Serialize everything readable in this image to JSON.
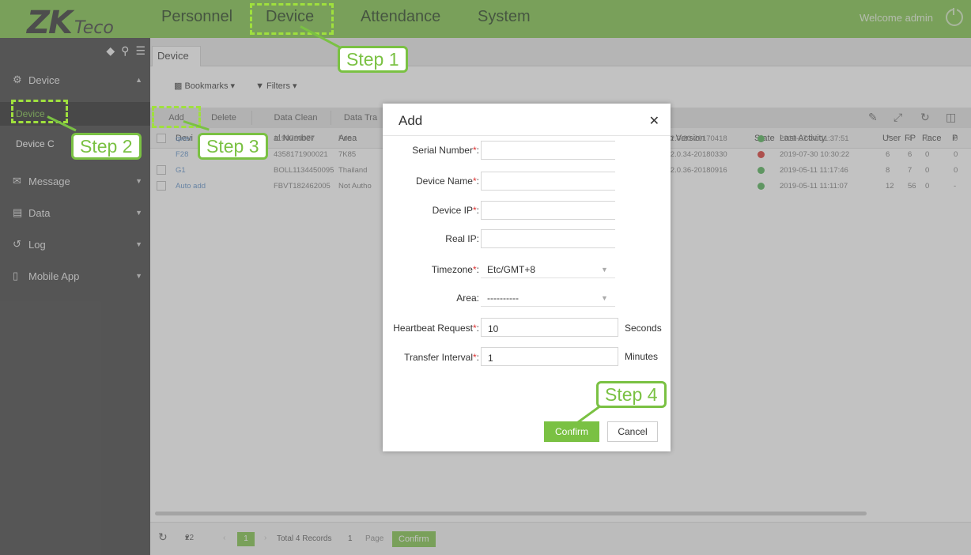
{
  "brand": {
    "logo_main": "ZK",
    "logo_sub": "Teco"
  },
  "nav": [
    "Personnel",
    "Device",
    "Attendance",
    "System"
  ],
  "welcome": "Welcome admin",
  "sidebar": {
    "groups": {
      "device": "Device",
      "message": "Message",
      "data": "Data",
      "log": "Log",
      "mobile": "Mobile App"
    },
    "items": [
      "Device",
      "Device C"
    ]
  },
  "tab": "Device",
  "filters": {
    "bookmarks": "Bookmarks",
    "filters": "Filters"
  },
  "toolbar": [
    "Add",
    "Delete",
    "Data Clean",
    "Data Tra"
  ],
  "grid": {
    "headers": {
      "device": "Devi",
      "serial": "al Number",
      "area": "Area",
      "fw": "sh Version",
      "state": "State",
      "last": "Last Activity",
      "user": "User",
      "fp": "FP",
      "face": "Face",
      "p": "P"
    },
    "rows": [
      {
        "name": "qwer",
        "serial": "1190760077",
        "area": "Prin",
        "fw": "r 2.0.20-20170418",
        "state": "ok",
        "last": "2019-07-31 11:37:51",
        "user": "7",
        "fp": "4",
        "face": "0",
        "p": "0"
      },
      {
        "name": "F28",
        "serial": "4358171900021",
        "area": "7K85",
        "fw": "r 2.0.34-20180330",
        "state": "error",
        "last": "2019-07-30 10:30:22",
        "user": "6",
        "fp": "6",
        "face": "0",
        "p": "0"
      },
      {
        "name": "G1",
        "serial": "BOLL1134450095",
        "area": "Thailand",
        "fw": "r 2.0.36-20180916",
        "state": "ok",
        "last": "2019-05-11 11:17:46",
        "user": "8",
        "fp": "7",
        "face": "0",
        "p": "0"
      },
      {
        "name": "Auto add",
        "serial": "FBVT182462005",
        "area": "Not Autho",
        "fw": "",
        "state": "ok",
        "last": "2019-05-11 11:11:07",
        "user": "12",
        "fp": "56",
        "face": "0",
        "p": "-"
      }
    ]
  },
  "pager": {
    "size": "22",
    "page": "1",
    "total": "Total 4 Records",
    "page_input": "1",
    "page_label": "Page",
    "confirm": "Confirm"
  },
  "modal": {
    "title": "Add",
    "fields": {
      "serial": {
        "label": "Serial Number",
        "required": true,
        "value": ""
      },
      "name": {
        "label": "Device Name",
        "required": true,
        "value": ""
      },
      "ip": {
        "label": "Device IP",
        "required": true,
        "value": ""
      },
      "realip": {
        "label": "Real IP",
        "required": false,
        "value": ""
      },
      "timezone": {
        "label": "Timezone",
        "required": true,
        "value": "Etc/GMT+8"
      },
      "area": {
        "label": "Area",
        "required": false,
        "value": "----------"
      },
      "heartbeat": {
        "label": "Heartbeat Request",
        "required": true,
        "value": "10",
        "unit": "Seconds"
      },
      "transfer": {
        "label": "Transfer Interval",
        "required": true,
        "value": "1",
        "unit": "Minutes"
      }
    },
    "confirm": "Confirm",
    "cancel": "Cancel"
  },
  "steps": [
    "Step 1",
    "Step 2",
    "Step 3",
    "Step 4"
  ],
  "colors": {
    "brand_green": "#7ac143",
    "highlight_green": "#9fe03d",
    "sidebar": "#3a3a3a",
    "error_red": "#d9302a"
  }
}
